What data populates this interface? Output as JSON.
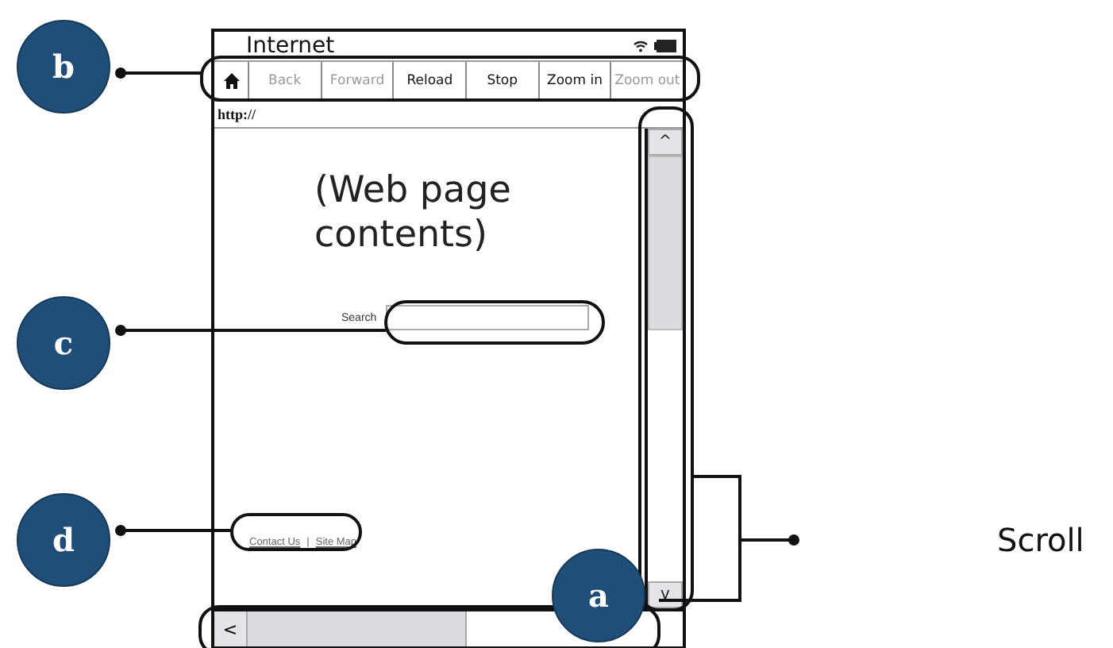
{
  "window": {
    "title": "Internet"
  },
  "toolbar": [
    {
      "kind": "home",
      "disabled": false
    },
    {
      "kind": "text",
      "label": "Back",
      "disabled": true
    },
    {
      "kind": "text",
      "label": "Forward",
      "disabled": true
    },
    {
      "kind": "text",
      "label": "Reload",
      "disabled": false
    },
    {
      "kind": "text",
      "label": "Stop",
      "disabled": false
    },
    {
      "kind": "text",
      "label": "Zoom in",
      "disabled": false
    },
    {
      "kind": "text",
      "label": "Zoom out",
      "disabled": true
    }
  ],
  "address_bar": {
    "value": "http://"
  },
  "page": {
    "heading": "(Web page contents)",
    "search_label": "Search",
    "links": [
      "Contact Us",
      "Site Map"
    ],
    "link_separator": "|"
  },
  "scrollbars": {
    "up": "^",
    "down": "v",
    "left": "<"
  },
  "callouts": [
    {
      "label": "b"
    },
    {
      "label": "c"
    },
    {
      "label": "d"
    },
    {
      "label": "a"
    }
  ],
  "scroll_label": "Scroll"
}
